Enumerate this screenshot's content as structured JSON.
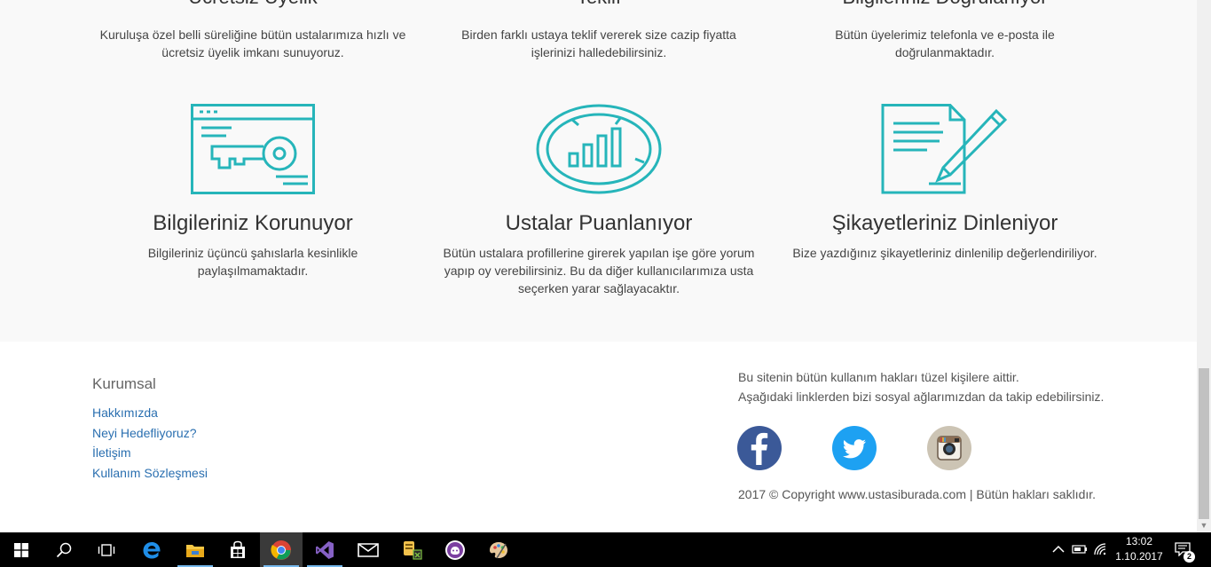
{
  "features_top": [
    {
      "title": "Ücretsiz Üyelik",
      "desc": "Kuruluşa özel belli süreliğine bütün ustalarımıza hızlı ve ücretsiz üyelik imkanı sunuyoruz."
    },
    {
      "title": "Teklif",
      "desc": "Birden farklı ustaya teklif vererek size cazip fiyatta işlerinizi halledebilirsiniz."
    },
    {
      "title": "Bilgileriniz Doğrulanıyor",
      "desc": "Bütün üyelerimiz telefonla ve e-posta ile doğrulanmaktadır."
    }
  ],
  "features": [
    {
      "title": "Bilgileriniz Korunuyor",
      "desc": "Bilgileriniz üçüncü şahıslarla kesinlikle paylaşılmamaktadır.",
      "icon": "key-browser-icon"
    },
    {
      "title": "Ustalar Puanlanıyor",
      "desc": "Bütün ustalara profillerine girerek yapılan işe göre yorum yapıp oy verebilirsiniz. Bu da diğer kullanıcılarımıza usta seçerken yarar sağlayacaktır.",
      "icon": "rating-chart-icon"
    },
    {
      "title": "Şikayetleriniz Dinleniyor",
      "desc": "Bize yazdığınız şikayetleriniz dinlenilip değerlendiriliyor.",
      "icon": "document-pen-icon"
    }
  ],
  "footer": {
    "heading": "Kurumsal",
    "links": [
      "Hakkımızda",
      "Neyi Hedefliyoruz?",
      "İletişim",
      "Kullanım Sözleşmesi"
    ],
    "rights_line1": "Bu sitenin bütün kullanım hakları tüzel kişilere aittir.",
    "rights_line2": "Aşağıdaki linklerden bizi sosyal ağlarımızdan da takip edebilirsiniz.",
    "copyright": "2017 © Copyright www.ustasiburada.com | Bütün hakları saklıdır."
  },
  "social": [
    {
      "name": "facebook-icon",
      "color": "#3b5998"
    },
    {
      "name": "twitter-icon",
      "color": "#1da1f2"
    },
    {
      "name": "instagram-icon",
      "color": "#ccc4b4"
    }
  ],
  "colors": {
    "accent": "#26b5ba",
    "link": "#2a6fb0"
  },
  "taskbar": {
    "apps": [
      "start-icon",
      "search-icon",
      "task-view-icon",
      "edge-icon",
      "file-explorer-icon",
      "store-icon",
      "chrome-icon",
      "visual-studio-icon",
      "mail-icon",
      "filezilla-icon",
      "app-icon",
      "paint-icon"
    ],
    "time": "13:02",
    "date": "1.10.2017",
    "notification_count": "2"
  }
}
